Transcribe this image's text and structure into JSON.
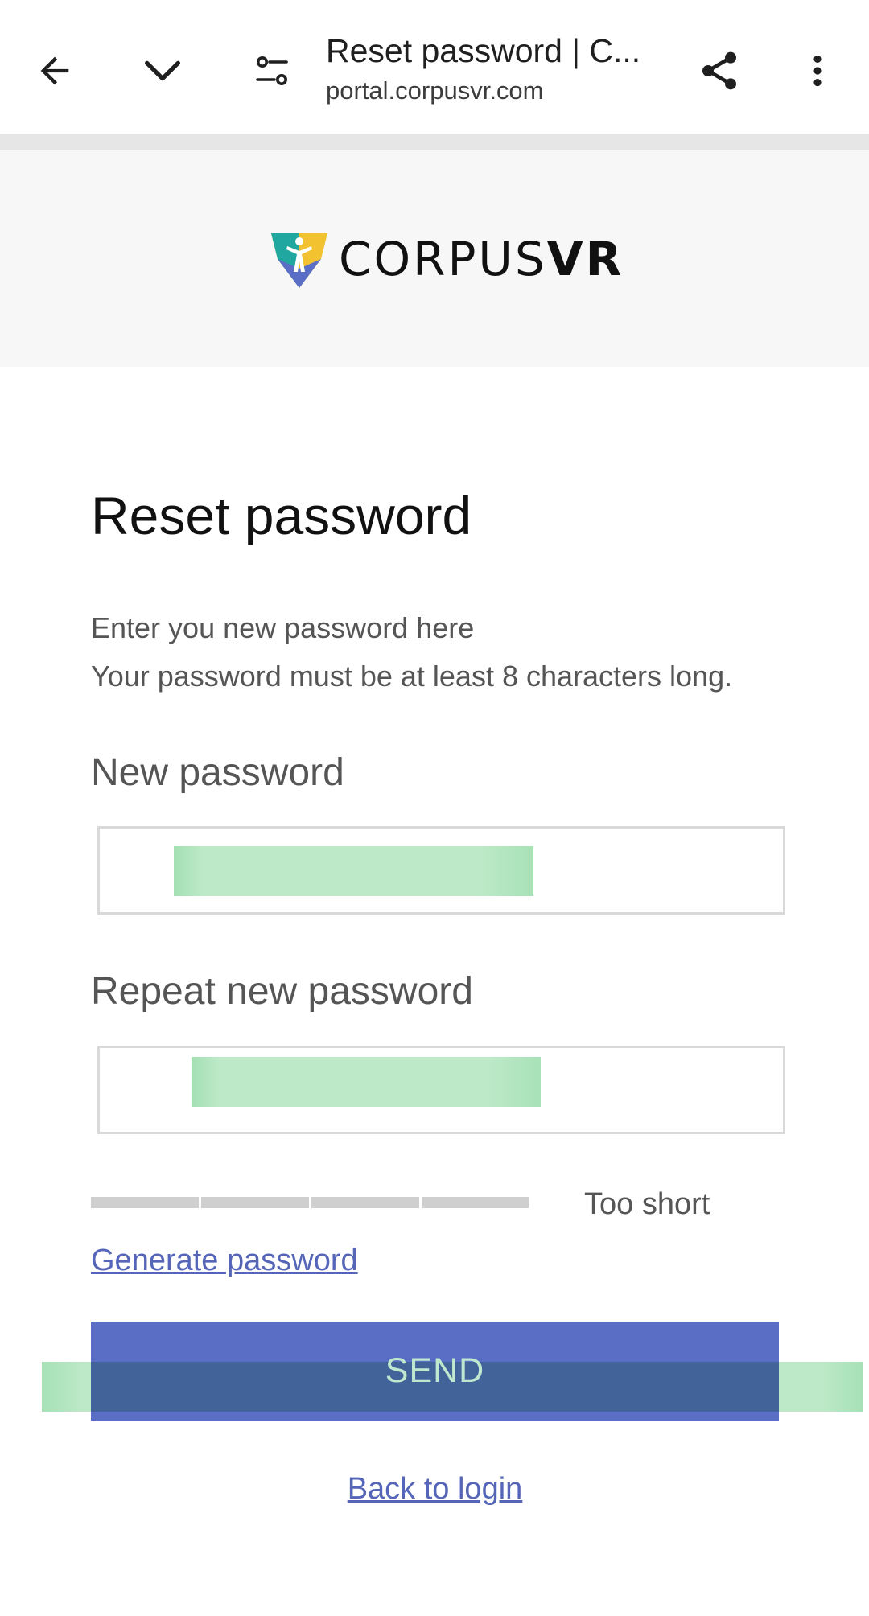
{
  "browser": {
    "page_title": "Reset password | C...",
    "url": "portal.corpusvr.com",
    "icons": {
      "back": "arrow-back-icon",
      "collapse": "chevron-down-icon",
      "site_settings": "tune-icon",
      "share": "share-icon",
      "menu": "more-vert-icon"
    }
  },
  "header": {
    "logo_light": "CORPUS",
    "logo_bold": "VR"
  },
  "form": {
    "title": "Reset password",
    "help_line_1": "Enter you new password here",
    "help_line_2": "Your password must be at least 8 characters long.",
    "new_password_label": "New password",
    "repeat_password_label": "Repeat new password",
    "strength_text": "Too short",
    "strength_level": 0,
    "strength_segments": 4,
    "generate_link": "Generate password",
    "send_label": "SEND",
    "back_link": "Back to login"
  },
  "colors": {
    "primary_button": "#5a6ec5",
    "link": "#5566b8",
    "header_bg": "#f7f7f7"
  }
}
